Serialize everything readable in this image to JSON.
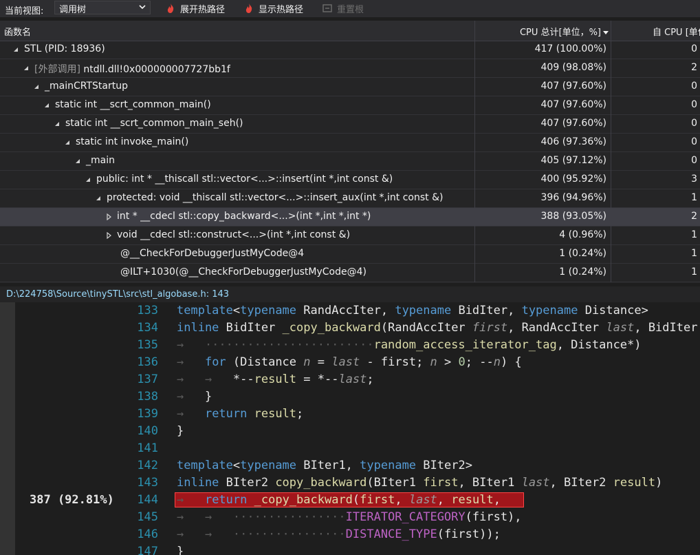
{
  "toolbar": {
    "view_label": "当前视图:",
    "view_value": "调用树",
    "expand_hot_path": "展开热路径",
    "show_hot_path": "显示热路径",
    "reset_root": "重置根"
  },
  "grid": {
    "columns": {
      "name": "函数名",
      "cpu_total": "CPU 总计[单位，%]",
      "self_cpu": "自 CPU [单位，%]"
    },
    "rows": [
      {
        "name": "STL (PID: 18936)",
        "cpu": "417 (100.00%)",
        "self": "0"
      },
      {
        "prefix": "[外部调用]",
        "name": " ntdll.dll!0x000000007727bb1f",
        "cpu": "409 (98.08%)",
        "self": "2"
      },
      {
        "name": "_mainCRTStartup",
        "cpu": "407 (97.60%)",
        "self": "0"
      },
      {
        "name": "static int __scrt_common_main()",
        "cpu": "407 (97.60%)",
        "self": "0"
      },
      {
        "name": "static int __scrt_common_main_seh()",
        "cpu": "407 (97.60%)",
        "self": "0"
      },
      {
        "name": "static int invoke_main()",
        "cpu": "406 (97.36%)",
        "self": "0"
      },
      {
        "name": "_main",
        "cpu": "405 (97.12%)",
        "self": "0"
      },
      {
        "name": "public: int * __thiscall stl::vector<...>::insert(int *,int const &)",
        "cpu": "400 (95.92%)",
        "self": "3"
      },
      {
        "name": "protected: void __thiscall stl::vector<...>::insert_aux(int *,int const &)",
        "cpu": "396 (94.96%)",
        "self": "1"
      },
      {
        "name": "int * __cdecl stl::copy_backward<...>(int *,int *,int *)",
        "cpu": "388 (93.05%)",
        "self": "2"
      },
      {
        "name": "void __cdecl stl::construct<...>(int *,int const &)",
        "cpu": "4 (0.96%)",
        "self": "1"
      },
      {
        "name": "@__CheckForDebuggerJustMyCode@4",
        "cpu": "1 (0.24%)",
        "self": "1"
      },
      {
        "name": "@ILT+1030(@__CheckForDebuggerJustMyCode@4)",
        "cpu": "1 (0.24%)",
        "self": "1"
      }
    ]
  },
  "editor": {
    "file_path": "D:\\224758\\Source\\tinySTL\\src\\stl_algobase.h: 143",
    "annotation": "387 (92.81%)",
    "lines": [
      "133",
      "134",
      "135",
      "136",
      "137",
      "138",
      "139",
      "140",
      "141",
      "142",
      "143",
      "144",
      "145",
      "146",
      "147"
    ]
  },
  "colors": {
    "highlight": "#a1161b",
    "keyword": "#569cd6",
    "function": "#dcdcaa",
    "macro": "#bd63c5",
    "line_number": "#2b91af"
  }
}
